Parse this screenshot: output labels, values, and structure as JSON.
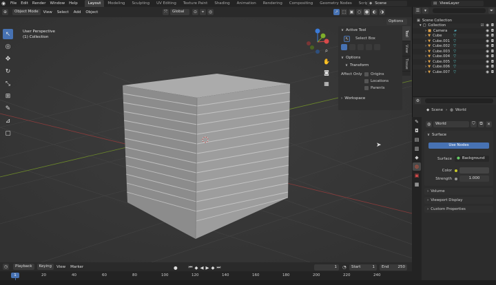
{
  "topbar": {
    "menus": [
      "File",
      "Edit",
      "Render",
      "Window",
      "Help"
    ],
    "workspaces": [
      "Layout",
      "Modeling",
      "Sculpting",
      "UV Editing",
      "Texture Paint",
      "Shading",
      "Animation",
      "Rendering",
      "Compositing",
      "Geometry Nodes",
      "Scripting"
    ],
    "active_workspace": "Layout",
    "scene": "Scene",
    "view_layer": "ViewLayer"
  },
  "header3d": {
    "mode": "Object Mode",
    "menus": [
      "View",
      "Select",
      "Add",
      "Object"
    ],
    "transform_orientation": "Global",
    "options": "Options"
  },
  "viewport": {
    "perspective_label": "User Perspective",
    "collection_label": "(1) Collection"
  },
  "npanel": {
    "active_tool_title": "Active Tool",
    "select_box": "Select Box",
    "options_title": "Options",
    "transform_title": "Transform",
    "affect_only": "Affect Only",
    "origins": "Origins",
    "locations": "Locations",
    "parents": "Parents",
    "workspace_title": "Workspace",
    "tabs": [
      "Tool",
      "View",
      "Tissue"
    ]
  },
  "outliner": {
    "root": "Scene Collection",
    "collection": "Collection",
    "items": [
      "Camera",
      "Cube",
      "Cube.001",
      "Cube.002",
      "Cube.003",
      "Cube.004",
      "Cube.005",
      "Cube.006",
      "Cube.007"
    ]
  },
  "properties": {
    "breadcrumb_scene": "Scene",
    "breadcrumb_world": "World",
    "world_name": "World",
    "surface_title": "Surface",
    "use_nodes": "Use Nodes",
    "surface_label": "Surface",
    "surface_value": "Background",
    "color_label": "Color",
    "strength_label": "Strength",
    "strength_value": "1.000",
    "volume": "Volume",
    "viewport_display": "Viewport Display",
    "custom_properties": "Custom Properties"
  },
  "timeline": {
    "menus": [
      "Playback",
      "Keying",
      "View",
      "Marker"
    ],
    "current_frame": "1",
    "start_label": "Start",
    "start_value": "1",
    "end_label": "End",
    "end_value": "250",
    "ruler_ticks": [
      "1",
      "20",
      "40",
      "60",
      "80",
      "100",
      "120",
      "140",
      "160",
      "180",
      "200",
      "220",
      "240"
    ]
  },
  "colors": {
    "accent": "#4772b3",
    "viewport_bg": "#393939",
    "cube_top": "#ababab",
    "cube_left": "#8c8c8c",
    "cube_right": "#9d9d9d"
  }
}
